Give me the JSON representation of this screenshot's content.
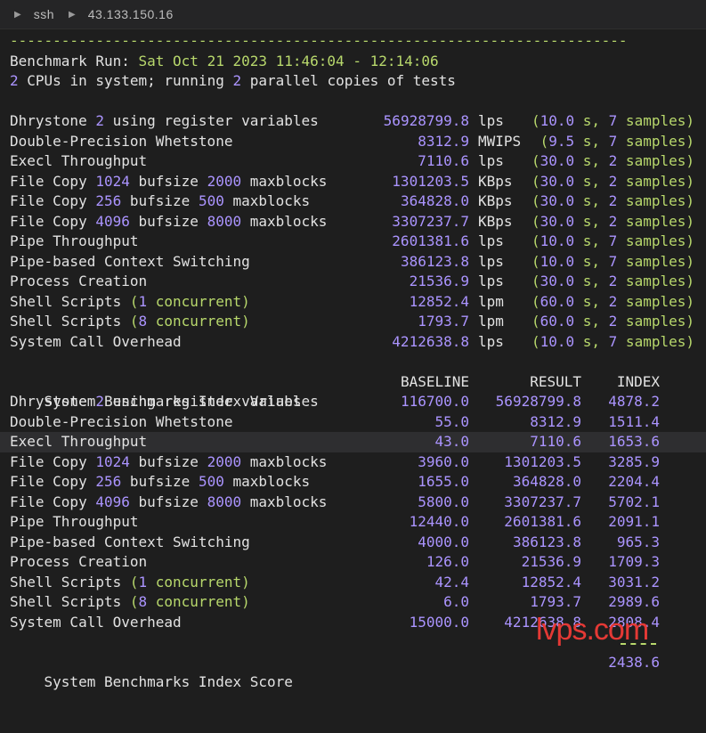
{
  "breadcrumb": {
    "items": [
      "ssh",
      "43.133.150.16"
    ]
  },
  "terminal": {
    "separator": "------------------------------------------------------------------------",
    "run": {
      "label": "Benchmark Run: ",
      "time": "Sat Oct 21 2023 11:46:04 - 12:14:06"
    },
    "cpus": {
      "n1": "2",
      "t1": " CPUs in system; running ",
      "n2": "2",
      "t2": " parallel copies of tests"
    },
    "tests": [
      {
        "parts": [
          [
            "w",
            "Dhrystone "
          ],
          [
            "num",
            "2"
          ],
          [
            "w",
            " using register variables"
          ]
        ],
        "value": "56928799.8",
        "unit": "lps",
        "secs": "10.0",
        "samples": "7"
      },
      {
        "parts": [
          [
            "w",
            "Double-Precision Whetstone"
          ]
        ],
        "value": "8312.9",
        "unit": "MWIPS",
        "secs": "9.5",
        "samples": "7"
      },
      {
        "parts": [
          [
            "w",
            "Execl Throughput"
          ]
        ],
        "value": "7110.6",
        "unit": "lps",
        "secs": "30.0",
        "samples": "2"
      },
      {
        "parts": [
          [
            "w",
            "File Copy "
          ],
          [
            "num",
            "1024"
          ],
          [
            "w",
            " bufsize "
          ],
          [
            "num",
            "2000"
          ],
          [
            "w",
            " maxblocks"
          ]
        ],
        "value": "1301203.5",
        "unit": "KBps",
        "secs": "30.0",
        "samples": "2"
      },
      {
        "parts": [
          [
            "w",
            "File Copy "
          ],
          [
            "num",
            "256"
          ],
          [
            "w",
            " bufsize "
          ],
          [
            "num",
            "500"
          ],
          [
            "w",
            " maxblocks"
          ]
        ],
        "value": "364828.0",
        "unit": "KBps",
        "secs": "30.0",
        "samples": "2"
      },
      {
        "parts": [
          [
            "w",
            "File Copy "
          ],
          [
            "num",
            "4096"
          ],
          [
            "w",
            " bufsize "
          ],
          [
            "num",
            "8000"
          ],
          [
            "w",
            " maxblocks"
          ]
        ],
        "value": "3307237.7",
        "unit": "KBps",
        "secs": "30.0",
        "samples": "2"
      },
      {
        "parts": [
          [
            "w",
            "Pipe Throughput"
          ]
        ],
        "value": "2601381.6",
        "unit": "lps",
        "secs": "10.0",
        "samples": "7"
      },
      {
        "parts": [
          [
            "w",
            "Pipe-based Context Switching"
          ]
        ],
        "value": "386123.8",
        "unit": "lps",
        "secs": "10.0",
        "samples": "7"
      },
      {
        "parts": [
          [
            "w",
            "Process Creation"
          ]
        ],
        "value": "21536.9",
        "unit": "lps",
        "secs": "30.0",
        "samples": "2"
      },
      {
        "parts": [
          [
            "w",
            "Shell Scripts "
          ],
          [
            "green",
            "("
          ],
          [
            "num",
            "1"
          ],
          [
            "green",
            " concurrent)"
          ]
        ],
        "value": "12852.4",
        "unit": "lpm",
        "secs": "60.0",
        "samples": "2"
      },
      {
        "parts": [
          [
            "w",
            "Shell Scripts "
          ],
          [
            "green",
            "("
          ],
          [
            "num",
            "8"
          ],
          [
            "green",
            " concurrent)"
          ]
        ],
        "value": "1793.7",
        "unit": "lpm",
        "secs": "60.0",
        "samples": "2"
      },
      {
        "parts": [
          [
            "w",
            "System Call Overhead"
          ]
        ],
        "value": "4212638.8",
        "unit": "lps",
        "secs": "10.0",
        "samples": "7"
      }
    ],
    "index_header": {
      "title": "System Benchmarks Index Values",
      "baseline": "BASELINE",
      "result": "RESULT",
      "index": "INDEX"
    },
    "index_rows": [
      {
        "parts": [
          [
            "w",
            "Dhrystone "
          ],
          [
            "num",
            "2"
          ],
          [
            "w",
            " using register variables"
          ]
        ],
        "baseline": "116700.0",
        "result": "56928799.8",
        "index": "4878.2"
      },
      {
        "parts": [
          [
            "w",
            "Double-Precision Whetstone"
          ]
        ],
        "baseline": "55.0",
        "result": "8312.9",
        "index": "1511.4"
      },
      {
        "parts": [
          [
            "w",
            "Execl Throughput"
          ]
        ],
        "baseline": "43.0",
        "result": "7110.6",
        "index": "1653.6"
      },
      {
        "parts": [
          [
            "w",
            "File Copy "
          ],
          [
            "num",
            "1024"
          ],
          [
            "w",
            " bufsize "
          ],
          [
            "num",
            "2000"
          ],
          [
            "w",
            " maxblocks"
          ]
        ],
        "baseline": "3960.0",
        "result": "1301203.5",
        "index": "3285.9"
      },
      {
        "parts": [
          [
            "w",
            "File Copy "
          ],
          [
            "num",
            "256"
          ],
          [
            "w",
            " bufsize "
          ],
          [
            "num",
            "500"
          ],
          [
            "w",
            " maxblocks"
          ]
        ],
        "baseline": "1655.0",
        "result": "364828.0",
        "index": "2204.4"
      },
      {
        "parts": [
          [
            "w",
            "File Copy "
          ],
          [
            "num",
            "4096"
          ],
          [
            "w",
            " bufsize "
          ],
          [
            "num",
            "8000"
          ],
          [
            "w",
            " maxblocks"
          ]
        ],
        "baseline": "5800.0",
        "result": "3307237.7",
        "index": "5702.1"
      },
      {
        "parts": [
          [
            "w",
            "Pipe Throughput"
          ]
        ],
        "baseline": "12440.0",
        "result": "2601381.6",
        "index": "2091.1"
      },
      {
        "parts": [
          [
            "w",
            "Pipe-based Context Switching"
          ]
        ],
        "baseline": "4000.0",
        "result": "386123.8",
        "index": "965.3"
      },
      {
        "parts": [
          [
            "w",
            "Process Creation"
          ]
        ],
        "baseline": "126.0",
        "result": "21536.9",
        "index": "1709.3"
      },
      {
        "parts": [
          [
            "w",
            "Shell Scripts "
          ],
          [
            "green",
            "("
          ],
          [
            "num",
            "1"
          ],
          [
            "green",
            " concurrent)"
          ]
        ],
        "baseline": "42.4",
        "result": "12852.4",
        "index": "3031.2"
      },
      {
        "parts": [
          [
            "w",
            "Shell Scripts "
          ],
          [
            "green",
            "("
          ],
          [
            "num",
            "8"
          ],
          [
            "green",
            " concurrent)"
          ]
        ],
        "baseline": "6.0",
        "result": "1793.7",
        "index": "2989.6"
      },
      {
        "parts": [
          [
            "w",
            "System Call Overhead"
          ]
        ],
        "baseline": "15000.0",
        "result": "4212638.8",
        "index": "2808.4"
      }
    ],
    "score": {
      "label": "System Benchmarks Index Score",
      "value": "2438.6"
    }
  },
  "watermark": "lvps.com",
  "colors": {
    "background": "#1e1e1e",
    "text": "#e2e2e2",
    "number": "#ab94ff",
    "green": "#b8d86c",
    "watermark": "#e53935"
  }
}
